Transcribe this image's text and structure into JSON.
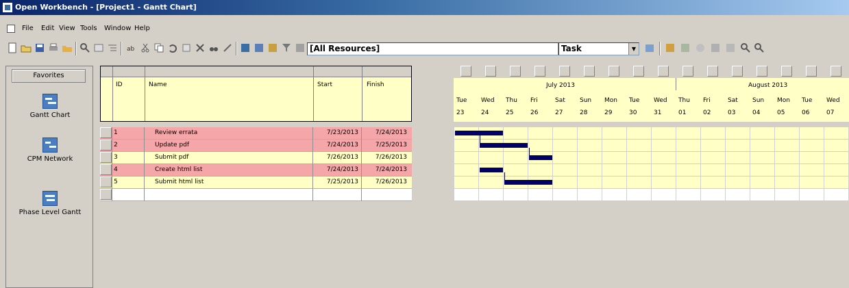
{
  "window": {
    "title": "Open Workbench - [Project1 - Gantt Chart]"
  },
  "menu": [
    "File",
    "Edit",
    "View",
    "Tools",
    "Window",
    "Help"
  ],
  "toolbar": {
    "resource_filter": "[All Resources]",
    "view_select": "Task"
  },
  "favorites": {
    "header": "Favorites",
    "items": [
      "Gantt Chart",
      "CPM Network",
      "Phase Level Gantt"
    ]
  },
  "grid": {
    "columns": [
      "ID",
      "Name",
      "Start",
      "Finish"
    ],
    "rows": [
      {
        "id": "1",
        "name": "Review errata",
        "start": "7/23/2013",
        "finish": "7/24/2013",
        "highlight": true
      },
      {
        "id": "2",
        "name": "Update pdf",
        "start": "7/24/2013",
        "finish": "7/25/2013",
        "highlight": true
      },
      {
        "id": "3",
        "name": "Submit pdf",
        "start": "7/26/2013",
        "finish": "7/26/2013",
        "highlight": false
      },
      {
        "id": "4",
        "name": "Create html list",
        "start": "7/24/2013",
        "finish": "7/24/2013",
        "highlight": true
      },
      {
        "id": "5",
        "name": "Submit html list",
        "start": "7/25/2013",
        "finish": "7/26/2013",
        "highlight": false
      }
    ]
  },
  "timeline": {
    "month1": "July 2013",
    "month2": "August 2013",
    "days": [
      {
        "dow": "Tue",
        "date": "23"
      },
      {
        "dow": "Wed",
        "date": "24"
      },
      {
        "dow": "Thu",
        "date": "25"
      },
      {
        "dow": "Fri",
        "date": "26"
      },
      {
        "dow": "Sat",
        "date": "27"
      },
      {
        "dow": "Sun",
        "date": "28"
      },
      {
        "dow": "Mon",
        "date": "29"
      },
      {
        "dow": "Tue",
        "date": "30"
      },
      {
        "dow": "Wed",
        "date": "31"
      },
      {
        "dow": "Thu",
        "date": "01"
      },
      {
        "dow": "Fri",
        "date": "02"
      },
      {
        "dow": "Sat",
        "date": "03"
      },
      {
        "dow": "Sun",
        "date": "04"
      },
      {
        "dow": "Mon",
        "date": "05"
      },
      {
        "dow": "Tue",
        "date": "06"
      },
      {
        "dow": "Wed",
        "date": "07"
      }
    ]
  },
  "colors": {
    "highlight_row": "#f4a6a8",
    "normal_row": "#ffffc6",
    "bar": "#000066"
  }
}
